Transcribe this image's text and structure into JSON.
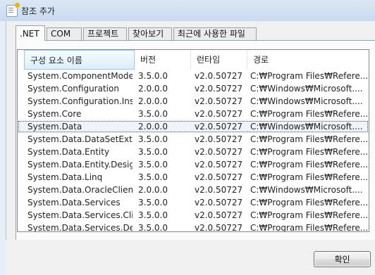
{
  "window": {
    "title": "참조 추가"
  },
  "tabs": [
    {
      "label": ".NET",
      "active": true
    },
    {
      "label": "COM",
      "active": false
    },
    {
      "label": "프로젝트",
      "active": false
    },
    {
      "label": "찾아보기",
      "active": false
    },
    {
      "label": "최근에 사용한 파일",
      "active": false
    }
  ],
  "table": {
    "columns": [
      "구성 요소 이름",
      "버전",
      "런타임",
      "경로"
    ],
    "rows": [
      [
        "System.ComponentModel...",
        "3.5.0.0",
        "v2.0.50727",
        "C:₩Program Files₩Refere..."
      ],
      [
        "System.Configuration",
        "2.0.0.0",
        "v2.0.50727",
        "C:₩Windows₩Microsoft...."
      ],
      [
        "System.Configuration.Install",
        "2.0.0.0",
        "v2.0.50727",
        "C:₩Windows₩Microsoft...."
      ],
      [
        "System.Core",
        "3.5.0.0",
        "v2.0.50727",
        "C:₩Program Files₩Refere..."
      ],
      [
        "System.Data",
        "2.0.0.0",
        "v2.0.50727",
        "C:₩Windows₩Microsoft...."
      ],
      [
        "System.Data.DataSetExten...",
        "3.5.0.0",
        "v2.0.50727",
        "C:₩Program Files₩Refere..."
      ],
      [
        "System.Data.Entity",
        "3.5.0.0",
        "v2.0.50727",
        "C:₩Program Files₩Refere..."
      ],
      [
        "System.Data.Entity.Design",
        "3.5.0.0",
        "v2.0.50727",
        "C:₩Program Files₩Refere..."
      ],
      [
        "System.Data.Linq",
        "3.5.0.0",
        "v2.0.50727",
        "C:₩Program Files₩Refere..."
      ],
      [
        "System.Data.OracleClient",
        "2.0.0.0",
        "v2.0.50727",
        "C:₩Windows₩Microsoft...."
      ],
      [
        "System.Data.Services",
        "3.5.0.0",
        "v2.0.50727",
        "C:₩Program Files₩Refere..."
      ],
      [
        "System.Data.Services.Client",
        "3.5.0.0",
        "v2.0.50727",
        "C:₩Program Files₩Refere..."
      ],
      [
        "System.Data.Services.Desi...",
        "3.5.0.0",
        "v2.0.50727",
        "C:₩Program Files₩Refere..."
      ]
    ],
    "selected_row": 4
  },
  "buttons": {
    "ok": "확인"
  }
}
